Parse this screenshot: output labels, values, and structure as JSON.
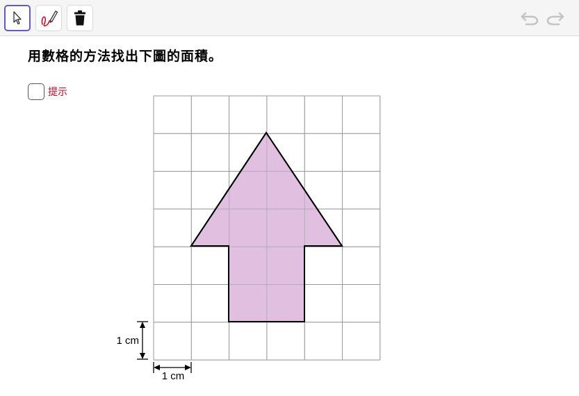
{
  "toolbar": {
    "tools": [
      {
        "name": "move-tool",
        "icon": "arrow-pointer-icon",
        "selected": true
      },
      {
        "name": "pen-tool",
        "icon": "pen-icon",
        "selected": false
      },
      {
        "name": "delete-tool",
        "icon": "trash-icon",
        "selected": false
      }
    ],
    "undo_icon": "undo-icon",
    "redo_icon": "redo-icon"
  },
  "question": "用數格的方法找出下圖的面積。",
  "hint": {
    "label": "提示",
    "checked": false,
    "color": "#d0021b"
  },
  "figure": {
    "grid": {
      "columns": 6,
      "rows": 7
    },
    "arrow_fill": "#dfbcdf",
    "arrow_stroke": "#000000",
    "grid_color": "#9a9a9a",
    "vertical_unit_label": "1 cm",
    "horizontal_unit_label": "1 cm"
  },
  "colors": {
    "accent": "#6557d2",
    "toolbar_bg": "#f5f5f5"
  }
}
